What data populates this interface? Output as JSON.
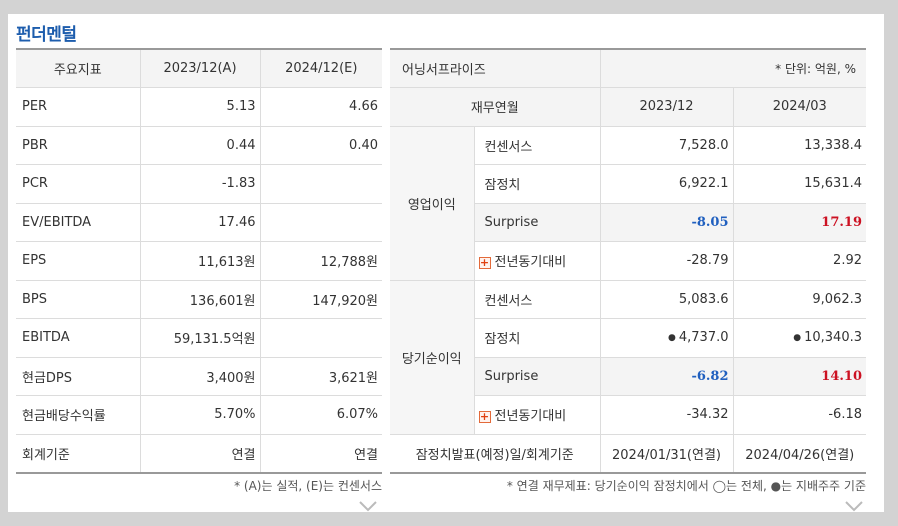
{
  "title": "펀더멘털",
  "left": {
    "headers": [
      "주요지표",
      "2023/12(A)",
      "2024/12(E)"
    ],
    "rows": [
      {
        "label": "PER",
        "a": "5.13",
        "e": "4.66"
      },
      {
        "label": "PBR",
        "a": "0.44",
        "e": "0.40"
      },
      {
        "label": "PCR",
        "a": "-1.83",
        "e": ""
      },
      {
        "label": "EV/EBITDA",
        "a": "17.46",
        "e": ""
      },
      {
        "label": "EPS",
        "a": "11,613원",
        "e": "12,788원"
      },
      {
        "label": "BPS",
        "a": "136,601원",
        "e": "147,920원"
      },
      {
        "label": "EBITDA",
        "a": "59,131.5억원",
        "e": ""
      },
      {
        "label": "현금DPS",
        "a": "3,400원",
        "e": "3,621원"
      },
      {
        "label": "현금배당수익률",
        "a": "5.70%",
        "e": "6.07%"
      },
      {
        "label": "회계기준",
        "a": "연결",
        "e": "연결"
      }
    ],
    "note": "* (A)는 실적, (E)는 컨센서스"
  },
  "right": {
    "title": "어닝서프라이즈",
    "unit": "* 단위: 억원, %",
    "headers": [
      "재무연월",
      "2023/12",
      "2024/03"
    ],
    "groups": [
      {
        "name": "영업이익",
        "rows": [
          {
            "item": "컨센서스",
            "v1": "7,528.0",
            "v2": "13,338.4"
          },
          {
            "item": "잠정치",
            "v1": "6,922.1",
            "v2": "15,631.4"
          },
          {
            "item": "Surprise",
            "v1": "-8.05",
            "v2": "17.19"
          },
          {
            "item": "전년동기대비",
            "v1": "-28.79",
            "v2": "2.92"
          }
        ]
      },
      {
        "name": "당기순이익",
        "rows": [
          {
            "item": "컨센서스",
            "v1": "5,083.6",
            "v2": "9,062.3"
          },
          {
            "item": "잠정치",
            "v1": "4,737.0",
            "v2": "10,340.3"
          },
          {
            "item": "Surprise",
            "v1": "-6.82",
            "v2": "14.10"
          },
          {
            "item": "전년동기대비",
            "v1": "-34.32",
            "v2": "-6.18"
          }
        ]
      }
    ],
    "footer_row": {
      "label": "잠정치발표(예정)일/회계기준",
      "v1": "2024/01/31(연결)",
      "v2": "2024/04/26(연결)"
    },
    "note": "* 연결 재무제표: 당기순이익 잠정치에서 ◯는 전체, ●는 지배주주 기준"
  },
  "icons": {
    "expand": "plus-icon",
    "more": "chevron-down-icon",
    "consolidated_dot": "filled-dot-icon"
  },
  "colors": {
    "title": "#1d5dad",
    "negative": "#1f5fbf",
    "positive": "#cc1122"
  }
}
